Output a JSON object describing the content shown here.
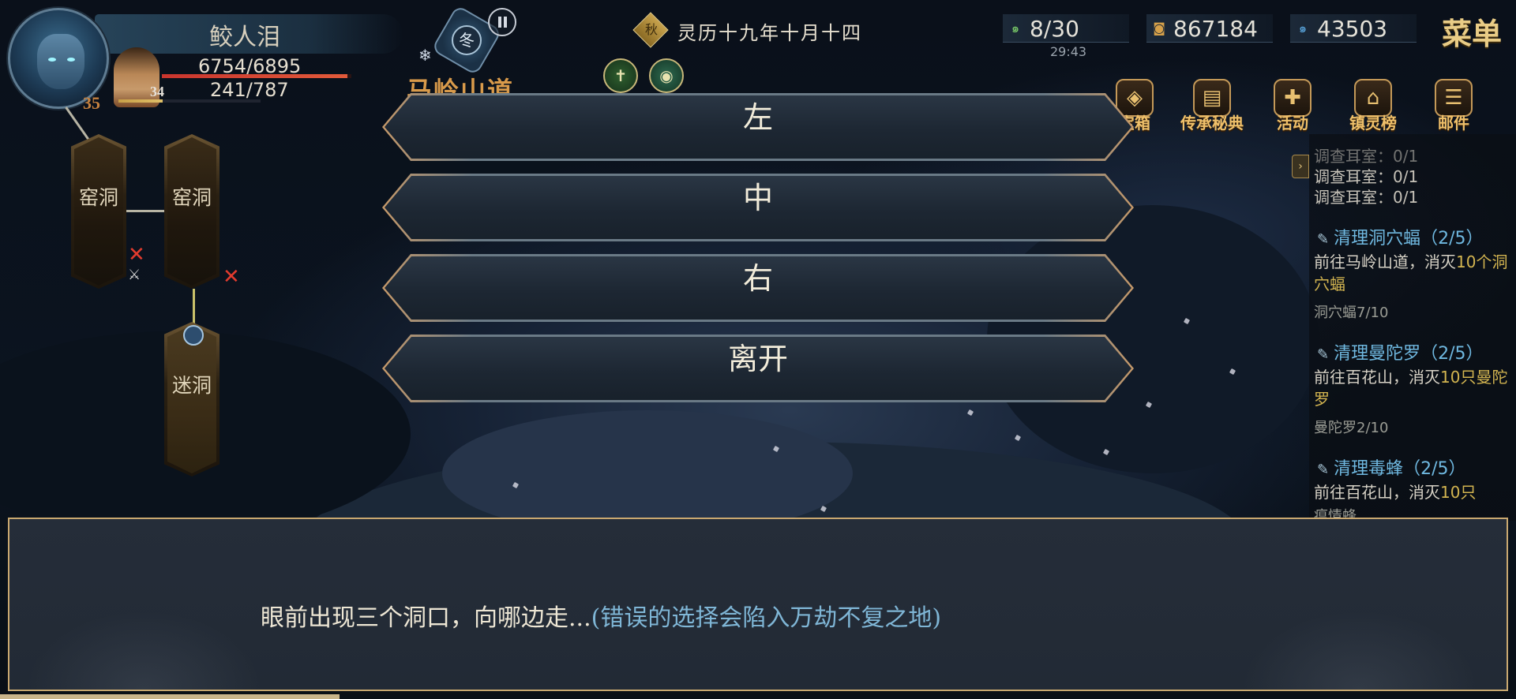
{
  "player": {
    "name": "鲛人泪",
    "level": "35",
    "companion_level": "34",
    "hp": "6754/6895",
    "mp": "241/787",
    "hp_ratio": 0.98,
    "mp_ratio": 0.31
  },
  "season_badge": "冬",
  "location": "马岭山道",
  "date": {
    "badge": "秋",
    "text": "灵历十九年十月十四"
  },
  "resources": {
    "stamina": "8/30",
    "stamina_timer": "29:43",
    "coins": "867184",
    "spirit": "43503"
  },
  "menu_label": "菜单",
  "shortcuts": [
    {
      "label": "宝箱",
      "icon": "treasure-icon"
    },
    {
      "label": "传承秘典",
      "icon": "book-icon"
    },
    {
      "label": "活动",
      "icon": "gift-icon"
    },
    {
      "label": "镇灵榜",
      "icon": "pagoda-icon"
    },
    {
      "label": "邮件",
      "icon": "scroll-icon"
    }
  ],
  "quests": {
    "truncated_line": "调查耳室：0/1",
    "investigate": [
      "调查耳室：0/1",
      "调查耳室：0/1"
    ],
    "list": [
      {
        "title": "清理洞穴蝠（2/5）",
        "desc_a": "前往马岭山道，消灭",
        "desc_hl": "10个洞穴蝠",
        "progress": "洞穴蝠7/10"
      },
      {
        "title": "清理曼陀罗（2/5）",
        "desc_a": "前往百花山，消灭",
        "desc_hl": "10只曼陀罗",
        "progress": "曼陀罗2/10"
      },
      {
        "title": "清理毒蜂（2/5）",
        "desc_a": "前往百花山，消灭",
        "desc_hl": "10只",
        "progress": "瘟情蜂"
      }
    ]
  },
  "map": {
    "rooms": [
      "窑洞",
      "窑洞",
      "迷洞"
    ]
  },
  "choices": [
    "左",
    "中",
    "右",
    "离开"
  ],
  "dialog": {
    "text": "眼前出现三个洞口，向哪边走...",
    "hint": "(错误的选择会陷入万劫不复之地)"
  }
}
